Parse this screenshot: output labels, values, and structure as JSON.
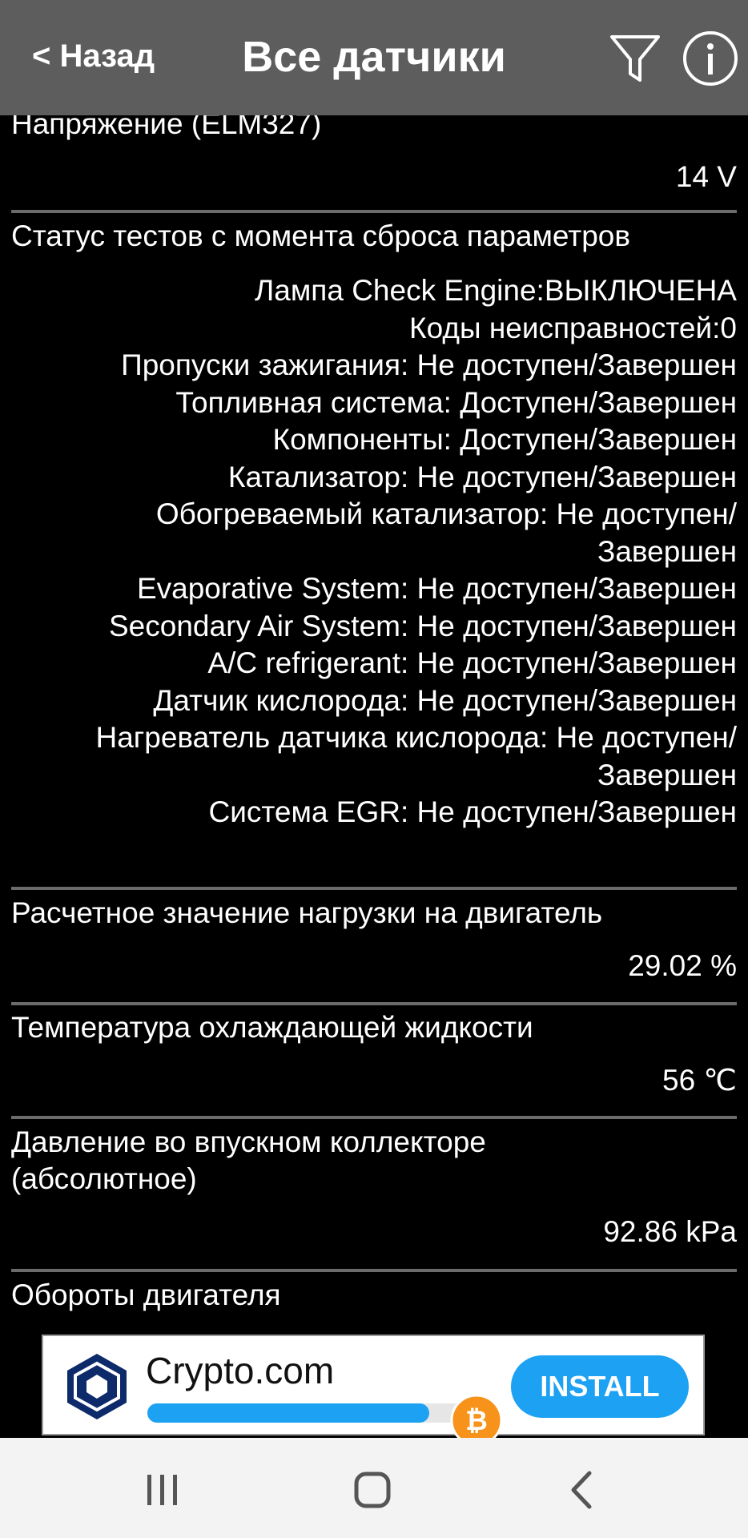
{
  "header": {
    "back_label": "< Назад",
    "title": "Все датчики",
    "color": "#5d5d5d",
    "filter_icon": "filter-icon",
    "info_icon": "info-icon"
  },
  "sensors": {
    "voltage": {
      "label": "Напряжение (ELM327)",
      "value": "14 V"
    },
    "tests": {
      "label": "Статус тестов с момента сброса параметров",
      "lines": [
        "Лампа Check Engine:ВЫКЛЮЧЕНА",
        "Коды неисправностей:0",
        "Пропуски зажигания: Не доступен/Завершен",
        "Топливная система: Доступен/Завершен",
        "Компоненты: Доступен/Завершен",
        "Катализатор: Не доступен/Завершен",
        "Обогреваемый катализатор: Не доступен/\nЗавершен",
        "Evaporative System: Не доступен/Завершен",
        "Secondary Air System: Не доступен/Завершен",
        "A/C refrigerant: Не доступен/Завершен",
        "Датчик кислорода: Не доступен/Завершен",
        "Нагреватель датчика кислорода: Не доступен/\nЗавершен",
        "Система EGR: Не доступен/Завершен"
      ]
    },
    "load": {
      "label": "Расчетное значение нагрузки на двигатель",
      "value": "29.02 %"
    },
    "coolant": {
      "label": "Температура охлаждающей жидкости",
      "value": "56 ℃"
    },
    "map": {
      "label": "Давление во впускном коллекторе\n(абсолютное)",
      "value": "92.86 kPa"
    },
    "rpm": {
      "label": "Обороты двигателя"
    }
  },
  "ad": {
    "brand": "Crypto.com",
    "install_label": "INSTALL",
    "accent": "#1da1f2",
    "progress_fraction": 0.8,
    "logo_icon": "crypto-com-logo",
    "coin_icon": "bitcoin-icon"
  },
  "navbar": {
    "recent_icon": "recent-apps-icon",
    "home_icon": "home-icon",
    "back_icon": "back-nav-icon"
  }
}
